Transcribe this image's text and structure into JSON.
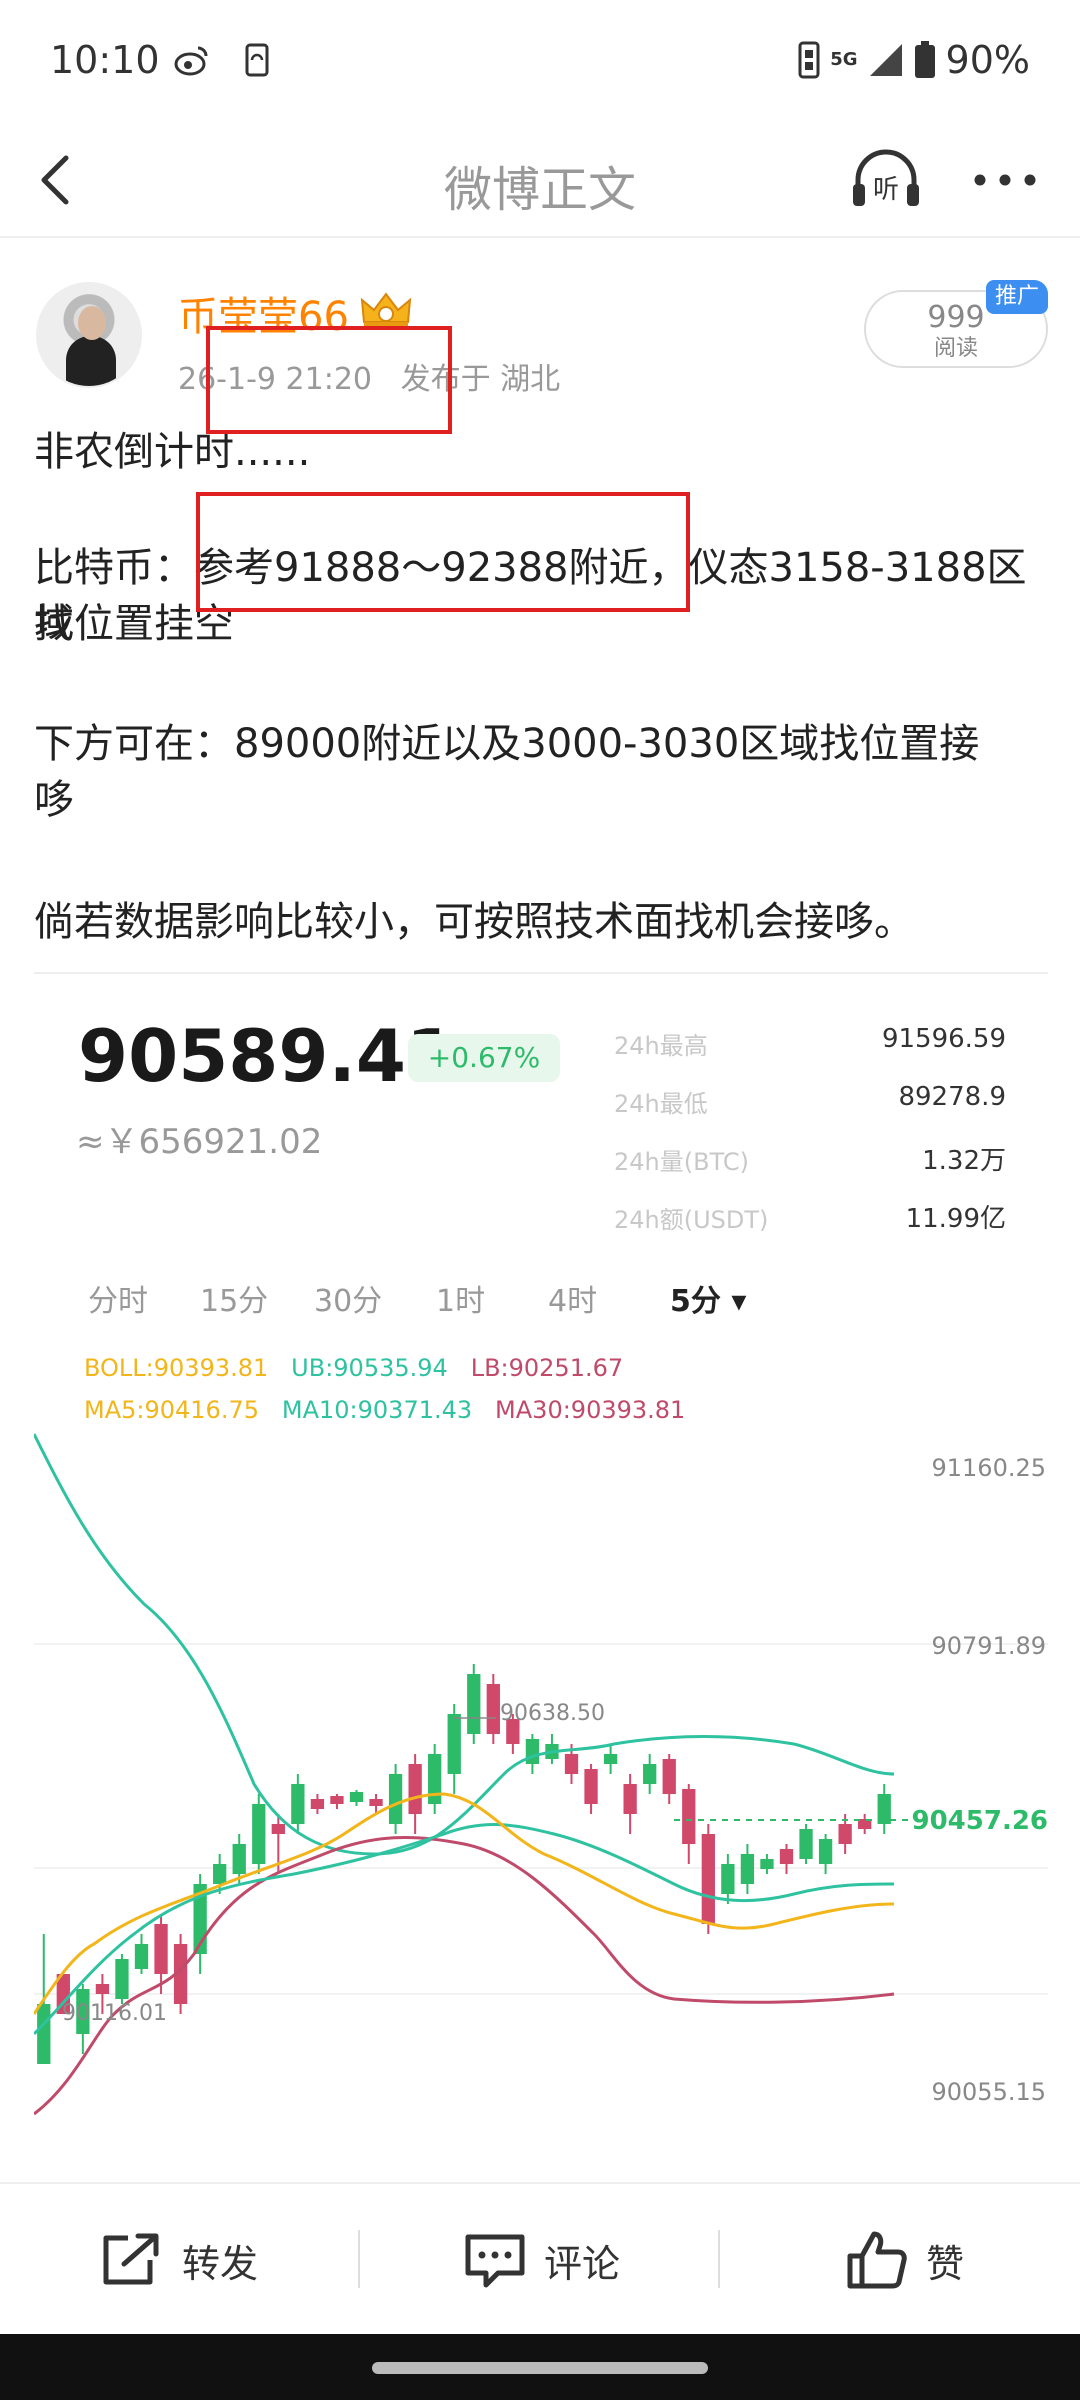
{
  "status_bar": {
    "time": "10:10",
    "network": "5G",
    "battery": "90%"
  },
  "nav": {
    "title": "微博正文",
    "listen_label": "听"
  },
  "post": {
    "author": "币莹莹66",
    "meta": "26-1-9 21:20   发布于 湖北",
    "read_count": "999",
    "read_label": "阅读",
    "promo_tag": "推广",
    "lines": [
      "非农倒计时......",
      "比特币：参考91888～92388附近，仪态3158-3188区域",
      "找位置挂空",
      "下方可在：89000附近以及3000-3030区域找位置接",
      "哆",
      "倘若数据影响比较小，可按照技术面找机会接哆。"
    ]
  },
  "chart": {
    "price": "90589.41",
    "change": "+0.67%",
    "price_cny": "≈￥656921.02",
    "stats": [
      {
        "label": "24h最高",
        "value": "91596.59"
      },
      {
        "label": "24h最低",
        "value": "89278.9"
      },
      {
        "label": "24h量(BTC)",
        "value": "1.32万"
      },
      {
        "label": "24h额(USDT)",
        "value": "11.99亿"
      }
    ],
    "timeframes": [
      "分时",
      "15分",
      "30分",
      "1时",
      "4时",
      "5分 ▾"
    ],
    "active_timeframe": 5,
    "boll_legend": {
      "boll": "BOLL:90393.81",
      "ub": "UB:90535.94",
      "lb": "LB:90251.67"
    },
    "ma_legend": {
      "ma5": "MA5:90416.75",
      "ma10": "MA10:90371.43",
      "ma30": "MA30:90393.81"
    },
    "axis_labels": [
      "91160.25",
      "90791.89",
      "90055.15"
    ],
    "last_price_label": "90457.26",
    "high_marker": "90638.50",
    "low_marker": "90116.01",
    "colors": {
      "up": "#2dbb6a",
      "down": "#d0486a",
      "ub_line": "#2ec2a0",
      "ma5": "#f2b51a",
      "ma10": "#2ec2a0",
      "ma30": "#c04a6a"
    }
  },
  "actions": {
    "repost": "转发",
    "comment": "评论",
    "like": "赞"
  }
}
